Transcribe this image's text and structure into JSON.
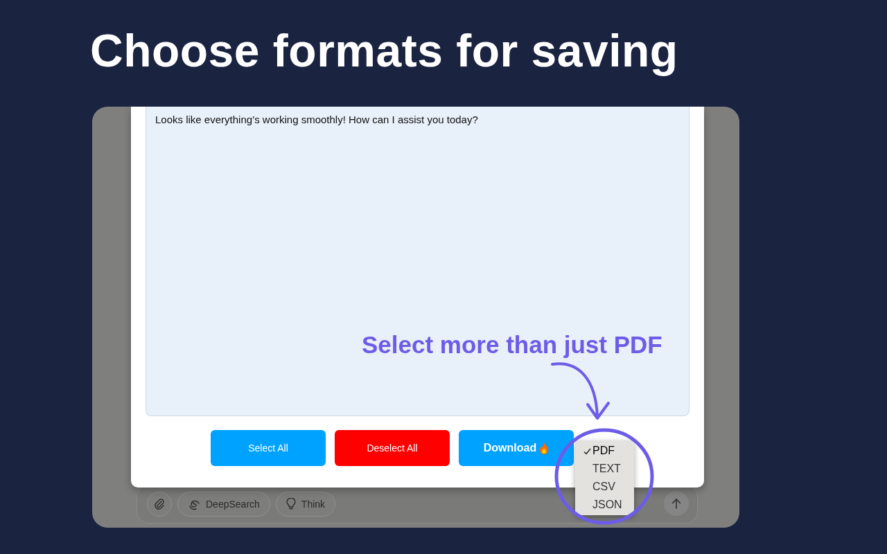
{
  "headline": "Choose formats for saving",
  "chat": {
    "message": "Looks like everything’s working smoothly! How can I assist you today?"
  },
  "buttons": [
    {
      "label": "Select All",
      "kind": "select"
    },
    {
      "label": "Deselect All",
      "kind": "deselect"
    },
    {
      "label": "Download",
      "kind": "download"
    }
  ],
  "format_menu": [
    {
      "label": "PDF",
      "selected": true
    },
    {
      "label": "TEXT",
      "selected": false
    },
    {
      "label": "CSV",
      "selected": false
    },
    {
      "label": "JSON",
      "selected": false
    }
  ],
  "input_bar": {
    "tools": [
      {
        "label": "DeepSearch",
        "kind": "deepsearch"
      },
      {
        "label": "Think",
        "kind": "think"
      }
    ]
  },
  "annotation": {
    "text": "Select more than just PDF"
  }
}
